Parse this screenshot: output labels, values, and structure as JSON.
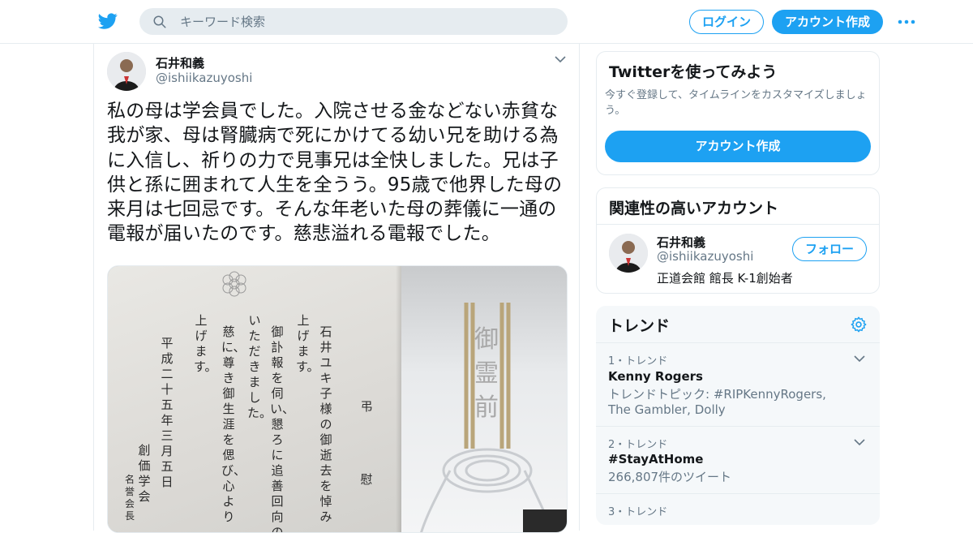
{
  "header": {
    "logo_icon": "twitter-bird-icon",
    "search_placeholder": "キーワード検索",
    "login_label": "ログイン",
    "signup_label": "アカウント作成",
    "more_icon": "more-dots-icon",
    "brand_color": "#1da1f2"
  },
  "tweet": {
    "author_name": "石井和義",
    "author_handle": "@ishiikazuyoshi",
    "text": "私の母は学会員でした。入院させる金などない赤貧な我が家、母は腎臓病で死にかけてる幼い兄を助ける為に入信し、祈りの力で見事兄は全快しました。兄は子供と孫に囲まれて人生を全うう。95歳で他界した母の来月は七回忌です。そんな年老いた母の葬儀に一通の電報が届いたのです。慈悲溢れる電報でした。",
    "photo": {
      "columns": [
        "弔",
        "慰",
        "石井　ユキ子　様の御逝去を悼み",
        "上げます。",
        "御訃報を伺い、懇ろに追善回向の",
        "いただきました。",
        "慈に、尊き御生涯を偲び、心より",
        "上げます。",
        "平成二十五年三月五日",
        "創価学会",
        "名誉会長"
      ],
      "envelope_text": "御霊前"
    }
  },
  "sidebar": {
    "signup_card": {
      "heading": "Twitterを使ってみよう",
      "subtext": "今すぐ登録して、タイムラインをカスタマイズしましょう。",
      "button_label": "アカウント作成"
    },
    "related": {
      "heading": "関連性の高いアカウント",
      "name": "石井和義",
      "handle": "@ishiikazuyoshi",
      "bio": "正道会館 館長 K-1創始者",
      "follow_label": "フォロー"
    },
    "trends": {
      "heading": "トレンド",
      "items": [
        {
          "meta": "1・トレンド",
          "title": "Kenny Rogers",
          "desc": "トレンドトピック: #RIPKennyRogers, The Gambler, Dolly"
        },
        {
          "meta": "2・トレンド",
          "title": "#StayAtHome",
          "desc": "266,807件のツイート"
        },
        {
          "meta": "3・トレンド",
          "title": "",
          "desc": ""
        }
      ]
    }
  }
}
